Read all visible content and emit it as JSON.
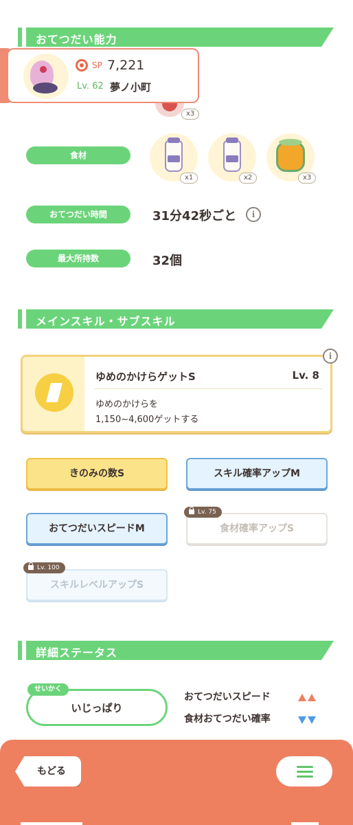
{
  "sections": {
    "help_ability": "おてつだい能力",
    "skills": "メインスキル・サブスキル",
    "details": "詳細ステータス"
  },
  "pokemon": {
    "sp_label": "SP",
    "sp_value": "7,221",
    "level": "Lv. 62",
    "name": "夢ノ小町"
  },
  "berry": {
    "count": "x3"
  },
  "ingredients": {
    "label": "食材",
    "items": [
      {
        "icon": "milk-bottle-icon",
        "count": "x1"
      },
      {
        "icon": "milk-bottle-icon",
        "count": "x2"
      },
      {
        "icon": "honey-jar-icon",
        "count": "x3"
      }
    ]
  },
  "help_time": {
    "label": "おてつだい時間",
    "value": "31分42秒ごと"
  },
  "max_carry": {
    "label": "最大所持数",
    "value": "32個"
  },
  "main_skill": {
    "name": "ゆめのかけらゲットS",
    "level": "Lv. 8",
    "desc_line1": "ゆめのかけらを",
    "desc_line2": "1,150~4,600ゲットする"
  },
  "sub_skills": [
    {
      "label": "きのみの数S",
      "style": "gold",
      "lock": ""
    },
    {
      "label": "スキル確率アップM",
      "style": "blue",
      "lock": ""
    },
    {
      "label": "おてつだいスピードM",
      "style": "blue",
      "lock": ""
    },
    {
      "label": "食材確率アップS",
      "style": "locked",
      "lock": "Lv. 75"
    },
    {
      "label": "スキルレベルアップS",
      "style": "locked-blue",
      "lock": "Lv. 100"
    }
  ],
  "nature": {
    "tag": "せいかく",
    "value": "いじっぱり",
    "up_stat": "おてつだいスピード",
    "down_stat": "食材おてつだい確率"
  },
  "nav": {
    "back": "もどる"
  },
  "colors": {
    "green": "#6bd47a",
    "orange": "#ee8060",
    "up": "#ee8260",
    "down": "#4e9be8"
  }
}
